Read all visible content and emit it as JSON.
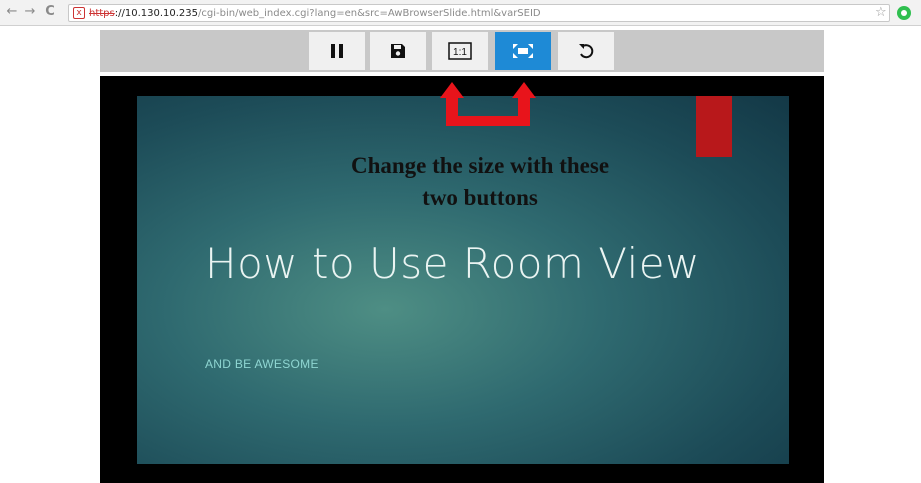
{
  "browser": {
    "back_icon": "←",
    "forward_icon": "→",
    "reload_icon": "C",
    "insecure_icon": "x",
    "url_scheme": "https",
    "url_host": "://10.130.10.235",
    "url_path": "/cgi-bin/web_index.cgi?lang=en&src=AwBrowserSlide.html&varSEID",
    "bookmark_icon": "☆"
  },
  "toolbar": {
    "buttons": [
      {
        "id": "pause",
        "icon": "pause-icon",
        "active": false
      },
      {
        "id": "save",
        "icon": "floppy-disk-icon",
        "active": false
      },
      {
        "id": "actual-size",
        "icon": "one-to-one-icon",
        "label": "1:1",
        "active": false
      },
      {
        "id": "fit-to-window",
        "icon": "fit-window-icon",
        "active": true
      },
      {
        "id": "rotate",
        "icon": "rotate-icon",
        "active": false
      }
    ],
    "active_color": "#1e8ad6"
  },
  "slide": {
    "title": "How to Use Room View",
    "subtitle": "AND BE AWESOME",
    "accent_color": "#b8181b"
  },
  "annotation": {
    "line1": "Change the size with these",
    "line2": "two buttons",
    "arrow_color": "#e8141b"
  }
}
